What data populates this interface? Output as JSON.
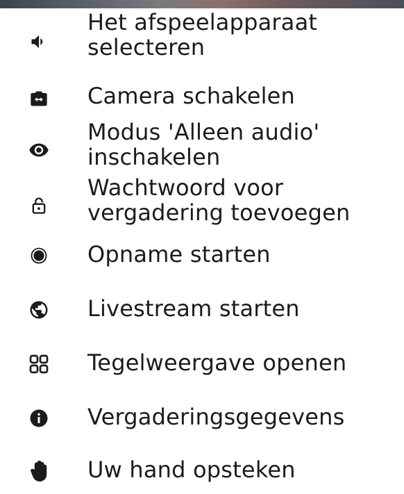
{
  "menu": {
    "items": [
      {
        "label_lines": [
          "Het afspeelapparaat",
          "selecteren"
        ],
        "icon": "volume-icon"
      },
      {
        "label_lines": [
          "Camera schakelen"
        ],
        "icon": "switch-camera-icon"
      },
      {
        "label_lines": [
          "Modus 'Alleen audio'",
          "inschakelen"
        ],
        "icon": "eye-icon"
      },
      {
        "label_lines": [
          "Wachtwoord voor",
          "vergadering toevoegen"
        ],
        "icon": "lock-open-icon"
      },
      {
        "label_lines": [
          "Opname starten"
        ],
        "icon": "record-icon"
      },
      {
        "label_lines": [
          "Livestream starten"
        ],
        "icon": "globe-icon"
      },
      {
        "label_lines": [
          "Tegelweergave openen"
        ],
        "icon": "tile-view-icon"
      },
      {
        "label_lines": [
          "Vergaderingsgegevens"
        ],
        "icon": "info-icon"
      },
      {
        "label_lines": [
          "Uw hand opsteken"
        ],
        "icon": "raise-hand-icon"
      }
    ]
  }
}
